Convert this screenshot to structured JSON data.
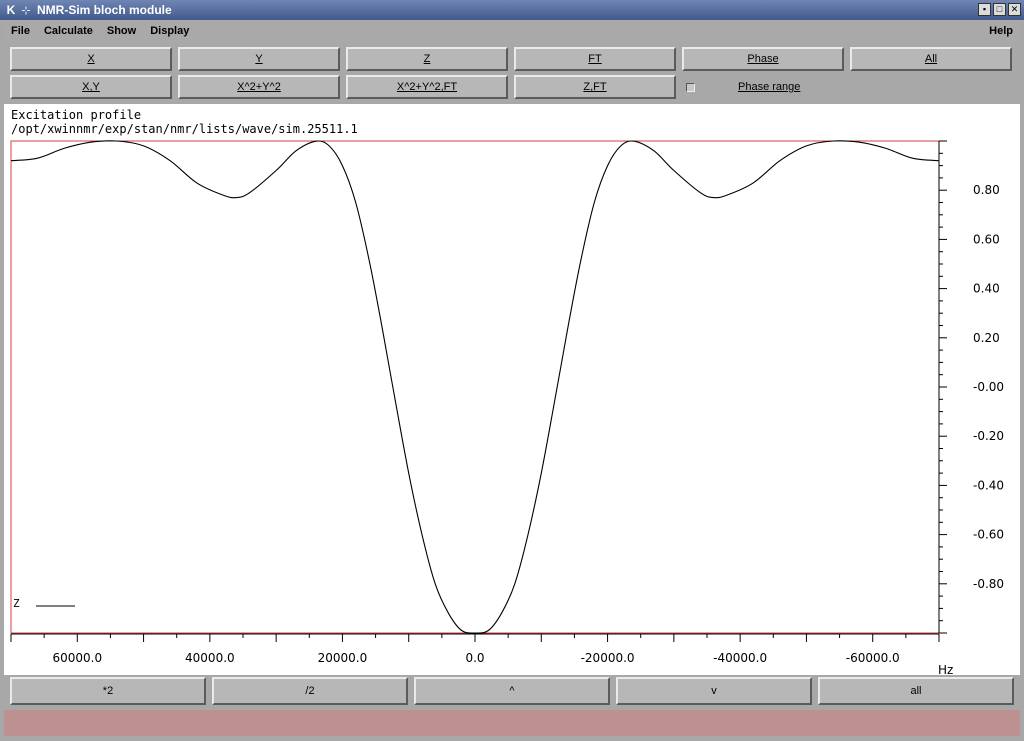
{
  "window": {
    "icon": "K",
    "title": "NMR-Sim bloch module",
    "controls": [
      "▪",
      "□",
      "✕"
    ]
  },
  "menu": {
    "file": "File",
    "calculate": "Calculate",
    "show": "Show",
    "display": "Display",
    "help": "Help"
  },
  "row1": [
    "X",
    "Y",
    "Z",
    "FT",
    "Phase",
    "All"
  ],
  "row2": [
    "X,Y",
    "X^2+Y^2",
    "X^2+Y^2,FT",
    "Z,FT"
  ],
  "phase_range_label": "Phase range",
  "plot": {
    "header_line1": "Excitation profile",
    "header_line2": "/opt/xwinnmr/exp/stan/nmr/lists/wave/sim.25511.1",
    "legend_label": "Z",
    "x_unit": "Hz",
    "x_tick_labels": [
      "60000.0",
      "40000.0",
      "20000.0",
      "0.0",
      "-20000.0",
      "-40000.0",
      "-60000.0"
    ],
    "y_tick_labels": [
      "0.80",
      "0.60",
      "0.40",
      "0.20",
      "-0.00",
      "-0.20",
      "-0.40",
      "-0.60",
      "-0.80"
    ]
  },
  "zoom_buttons": [
    "*2",
    "/2",
    "^",
    "v",
    "all"
  ],
  "chart_data": {
    "type": "line",
    "title": "Excitation profile",
    "xlabel": "Hz",
    "ylabel": "",
    "x_reversed": true,
    "xlim": [
      70000,
      -70000
    ],
    "ylim": [
      -1.0,
      1.0
    ],
    "series": [
      {
        "name": "Z",
        "x": [
          70000,
          66000,
          62000,
          58000,
          54000,
          50000,
          46000,
          42000,
          38000,
          36000,
          34000,
          30000,
          27000,
          24000,
          22000,
          20000,
          18000,
          16000,
          14000,
          12000,
          10000,
          8000,
          6000,
          4000,
          2000,
          0,
          -2000,
          -4000,
          -6000,
          -8000,
          -10000,
          -12000,
          -14000,
          -16000,
          -18000,
          -20000,
          -22000,
          -24000,
          -27000,
          -30000,
          -34000,
          -36000,
          -38000,
          -42000,
          -46000,
          -50000,
          -54000,
          -58000,
          -62000,
          -66000,
          -70000
        ],
        "y": [
          0.92,
          0.93,
          0.97,
          0.995,
          1.0,
          0.98,
          0.92,
          0.83,
          0.78,
          0.77,
          0.79,
          0.88,
          0.96,
          0.999,
          0.98,
          0.9,
          0.75,
          0.52,
          0.24,
          -0.06,
          -0.35,
          -0.6,
          -0.8,
          -0.92,
          -0.99,
          -1.0,
          -0.99,
          -0.92,
          -0.8,
          -0.6,
          -0.35,
          -0.06,
          0.24,
          0.52,
          0.75,
          0.9,
          0.98,
          0.999,
          0.96,
          0.88,
          0.79,
          0.77,
          0.78,
          0.83,
          0.92,
          0.98,
          1.0,
          0.995,
          0.97,
          0.93,
          0.92
        ]
      }
    ],
    "grid": false
  }
}
